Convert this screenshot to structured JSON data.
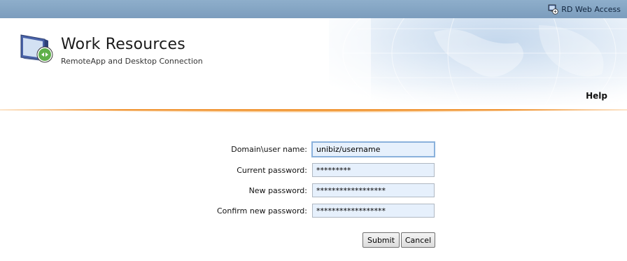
{
  "topbar": {
    "rd_web_access": "RD Web Access",
    "icon": "rd-web-access-icon"
  },
  "header": {
    "title": "Work Resources",
    "subtitle": "RemoteApp and Desktop Connection",
    "help": "Help",
    "app_icon": "remoteapp-monitor-icon"
  },
  "form": {
    "fields": [
      {
        "label": "Domain\\user name:",
        "value": "unibiz/username"
      },
      {
        "label": "Current password:",
        "value": "*********"
      },
      {
        "label": "New password:",
        "value": "******************"
      },
      {
        "label": "Confirm new password:",
        "value": "******************"
      }
    ],
    "submit": "Submit",
    "cancel": "Cancel"
  },
  "colors": {
    "topbar": "#8eaecb",
    "accent_orange": "#f0902a",
    "input_bg": "#e6f0fc"
  }
}
